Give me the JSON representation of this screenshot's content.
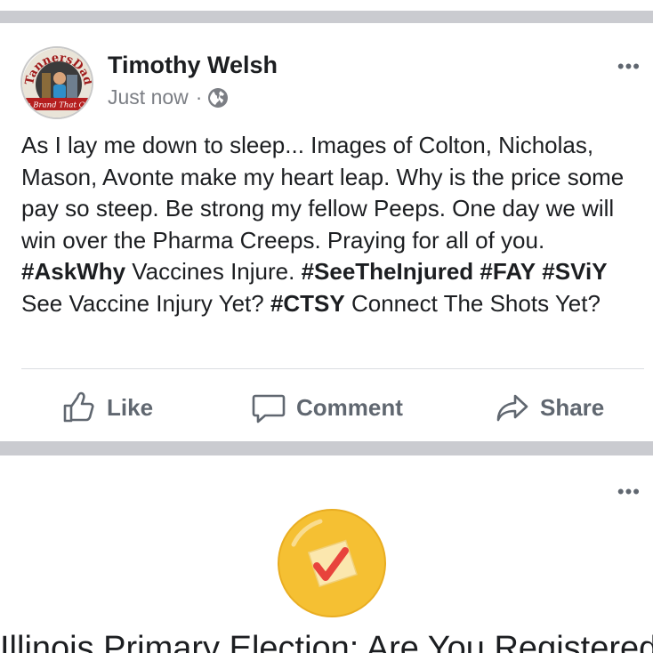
{
  "post": {
    "author": "Timothy Welsh",
    "timestamp": "Just now",
    "separator": "·",
    "audience_icon": "globe-icon",
    "avatar": {
      "arc_text": "TannersDad",
      "banner_text": "The Brand That Cares"
    },
    "more_label": "•••",
    "text_segments": [
      {
        "text": "As I lay me down to sleep... Images of Colton, Nicholas, Mason, Avonte make my heart leap. Why is the price some pay so steep. Be strong my fellow Peeps. One day we will win over the Pharma Creeps. Praying for all of you. ",
        "bold": false
      },
      {
        "text": "#AskWhy",
        "bold": true
      },
      {
        "text": " Vaccines Injure. ",
        "bold": false
      },
      {
        "text": "#SeeTheInjured",
        "bold": true
      },
      {
        "text": " ",
        "bold": false
      },
      {
        "text": "#FAY",
        "bold": true
      },
      {
        "text": " ",
        "bold": false
      },
      {
        "text": "#SViY",
        "bold": true
      },
      {
        "text": " See Vaccine Injury Yet? ",
        "bold": false
      },
      {
        "text": "#CTSY",
        "bold": true
      },
      {
        "text": " Connect The Shots Yet?",
        "bold": false
      }
    ],
    "actions": {
      "like": "Like",
      "comment": "Comment",
      "share": "Share"
    }
  },
  "card": {
    "more_label": "•••",
    "badge_icon": "vote-checkmark-icon",
    "title": "Illinois Primary Election: Are You Registered"
  },
  "colors": {
    "band": "#cacbd0",
    "action_text": "#606770",
    "meta_text": "#7b7e84",
    "badge_yellow": "#f5c033",
    "check_red": "#e8433c"
  }
}
